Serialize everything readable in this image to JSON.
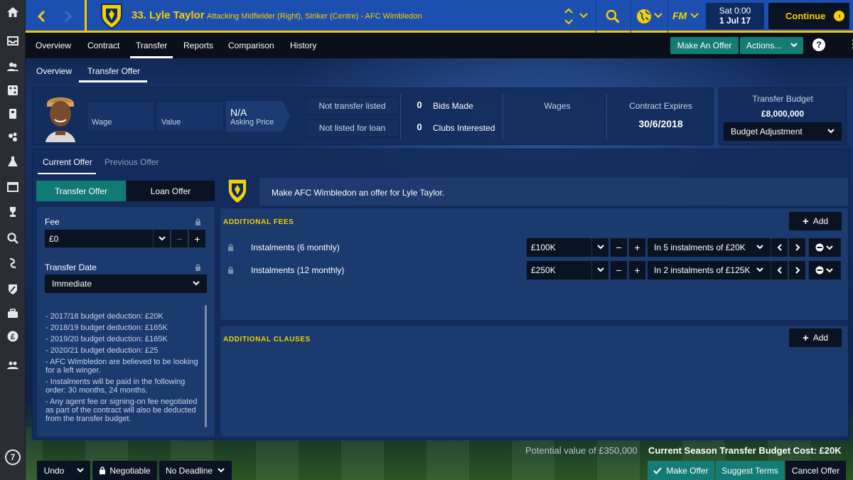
{
  "header": {
    "player_name": "33. Lyle Taylor",
    "player_desc": "Attacking Midfielder (Right), Striker (Centre) - AFC Wimbledon",
    "date_day": "Sat 0:00",
    "date_date": "1 Jul 17",
    "continue_label": "Continue",
    "fm_logo": "FM",
    "accent_color": "#f5d000",
    "bar_color": "#1d4fb0"
  },
  "tabs": [
    "Overview",
    "Contract",
    "Transfer",
    "Reports",
    "Comparison",
    "History"
  ],
  "active_tab": "Transfer",
  "tab_actions": {
    "make_offer": "Make An Offer",
    "actions": "Actions..."
  },
  "subtabs": [
    "Overview",
    "Transfer Offer"
  ],
  "card": {
    "wage_label": "Wage",
    "value_label": "Value",
    "asking_value": "N/A",
    "asking_label": "Asking Price",
    "transfer_status": "Not transfer listed",
    "loan_status": "Not listed for loan",
    "bids_count": "0",
    "bids_label": "Bids Made",
    "clubs_count": "0",
    "clubs_label": "Clubs Interested",
    "wages_label": "Wages",
    "contract_label": "Contract Expires",
    "contract_value": "30/6/2018"
  },
  "budget": {
    "title": "Transfer Budget",
    "value": "£8,000,000",
    "adjust": "Budget Adjustment"
  },
  "offer_tabs": {
    "current": "Current Offer",
    "previous": "Previous Offer"
  },
  "offer_type": {
    "transfer": "Transfer Offer",
    "loan": "Loan Offer"
  },
  "left": {
    "fee_label": "Fee",
    "fee_value": "£0",
    "date_label": "Transfer Date",
    "date_value": "Immediate",
    "notes": [
      "- 2017/18 budget deduction: £20K",
      "- 2018/19 budget deduction: £165K",
      "- 2019/20 budget deduction: £165K",
      "- 2020/21 budget deduction: £25",
      "- AFC Wimbledon are believed to be looking for a left winger.",
      "- Instalments will be paid in the following order: 30 months, 24 months.",
      "- Any agent fee or signing-on fee negotiated as part of the contract will also be deducted from the transfer budget."
    ]
  },
  "offer_text": "Make AFC Wimbledon an offer for Lyle Taylor.",
  "fees": {
    "title": "ADDITIONAL FEES",
    "add": "Add",
    "rows": [
      {
        "name": "Instalments (6 monthly)",
        "amount": "£100K",
        "plan": "In 5 instalments of £20K"
      },
      {
        "name": "Instalments (12 monthly)",
        "amount": "£250K",
        "plan": "In 2 instalments of £125K"
      }
    ]
  },
  "clauses": {
    "title": "ADDITIONAL CLAUSES",
    "add": "Add"
  },
  "footer": {
    "potential": "Potential value of £350,000",
    "budget_cost": "Current Season Transfer Budget Cost: £20K",
    "undo": "Undo",
    "negotiable": "Negotiable",
    "deadline": "No Deadline",
    "make_offer": "Make Offer",
    "suggest": "Suggest Terms",
    "cancel": "Cancel Offer"
  },
  "rail_badge": "7"
}
